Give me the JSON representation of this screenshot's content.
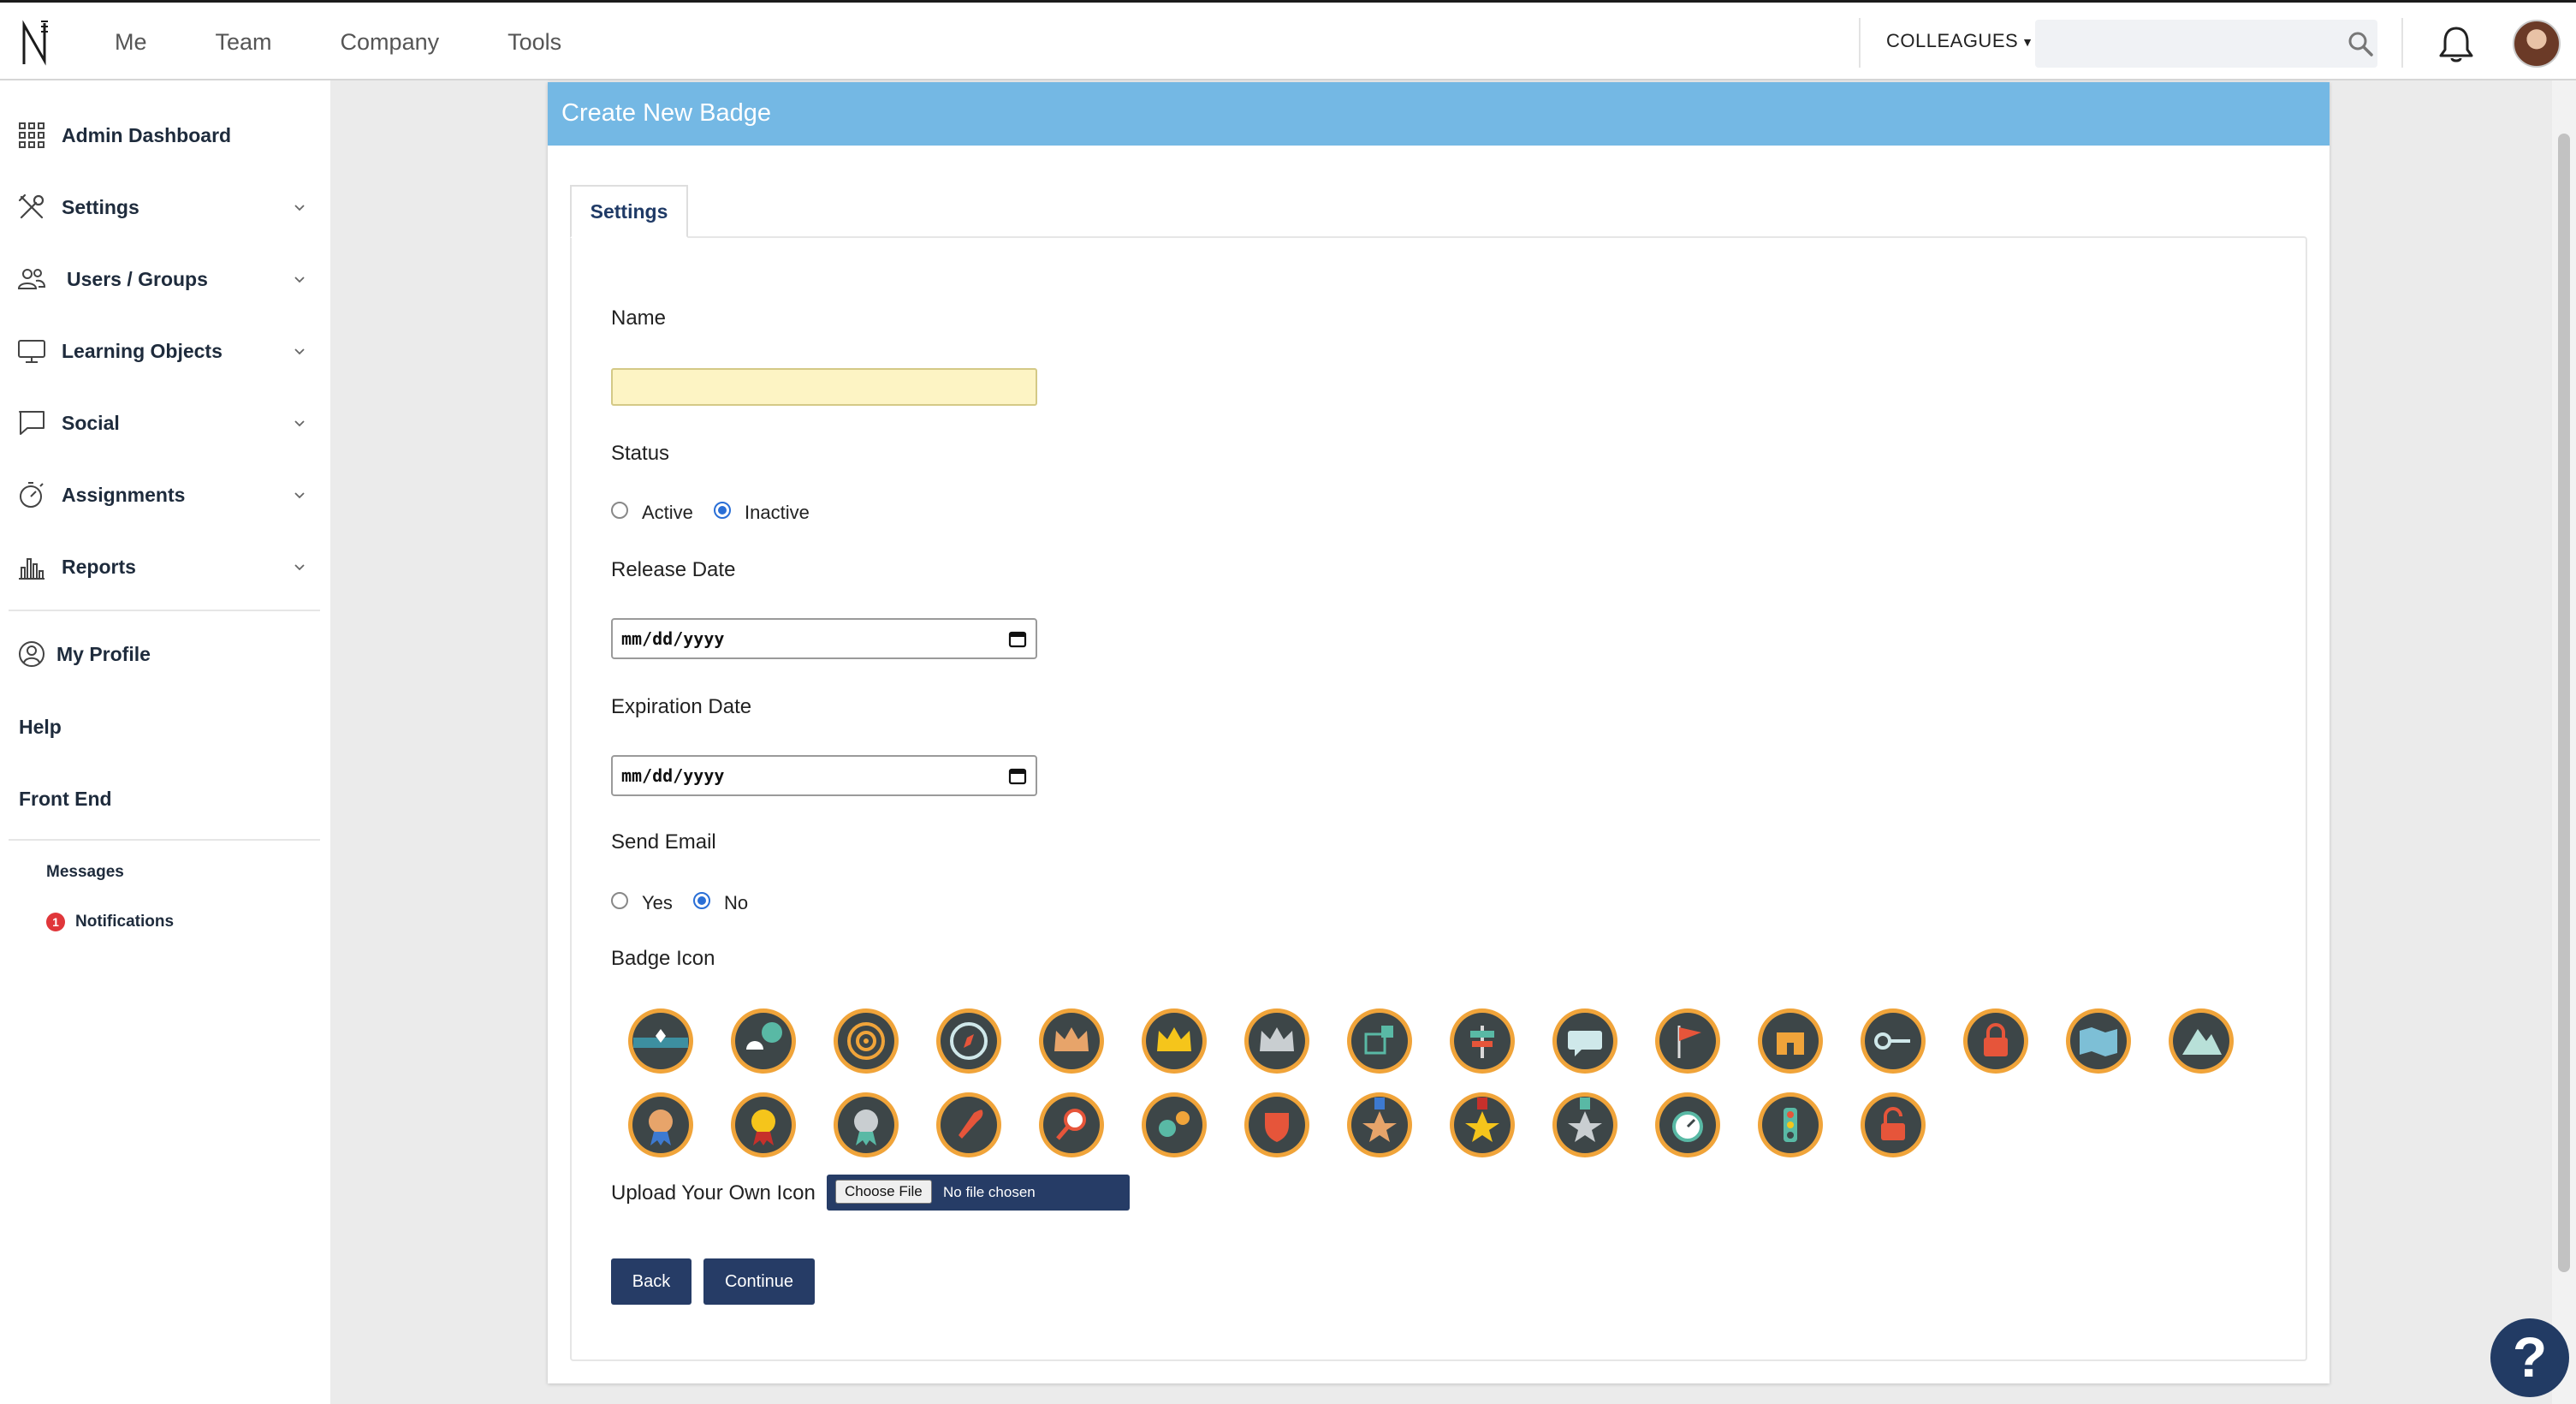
{
  "nav": {
    "links": [
      "Me",
      "Team",
      "Company",
      "Tools"
    ],
    "colleagues_label": "COLLEAGUES",
    "search_placeholder": ""
  },
  "sidebar": {
    "items": [
      {
        "label": "Admin Dashboard",
        "icon": "grid-icon"
      },
      {
        "label": "Settings",
        "icon": "tools-icon"
      },
      {
        "label": "Users / Groups",
        "icon": "users-icon"
      },
      {
        "label": "Learning Objects",
        "icon": "monitor-icon"
      },
      {
        "label": "Social",
        "icon": "chat-icon"
      },
      {
        "label": "Assignments",
        "icon": "stopwatch-icon"
      },
      {
        "label": "Reports",
        "icon": "bar-chart-icon"
      }
    ],
    "my_profile": "My Profile",
    "help": "Help",
    "front_end": "Front End",
    "messages": "Messages",
    "notifications": "Notifications",
    "notifications_count": "1"
  },
  "panel": {
    "title": "Create New Badge",
    "tab": "Settings"
  },
  "form": {
    "name_label": "Name",
    "name_value": "",
    "status_label": "Status",
    "status_options": [
      "Active",
      "Inactive"
    ],
    "status_selected": "Inactive",
    "release_label": "Release Date",
    "release_value": "mm/dd/yyyy",
    "expiration_label": "Expiration Date",
    "expiration_value": "mm/dd/yyyy",
    "email_label": "Send Email",
    "email_options": [
      "Yes",
      "No"
    ],
    "email_selected": "No",
    "badge_icon_label": "Badge Icon",
    "badge_icons": [
      "trophy-banner-icon",
      "lightbulb-cloud-icon",
      "target-icon",
      "compass-icon",
      "bronze-crown-icon",
      "gold-crown-icon",
      "silver-crown-icon",
      "dice-icon",
      "signpost-icon",
      "speech-bubble-icon",
      "flag-icon",
      "castle-icon",
      "key-icon",
      "padlock-icon",
      "treasure-map-icon",
      "mountain-icon",
      "bronze-medal-icon",
      "gold-medal-icon",
      "silver-medal-icon",
      "rocket-icon",
      "magnifier-icon",
      "gears-icon",
      "shield-icon",
      "bronze-star-medal-icon",
      "gold-star-medal-icon",
      "silver-star-medal-icon",
      "stopwatch-icon",
      "traffic-light-icon",
      "open-padlock-icon"
    ],
    "upload_label": "Upload Your Own Icon",
    "choose_file": "Choose File",
    "no_file": "No file chosen",
    "back_button": "Back",
    "continue_button": "Continue"
  },
  "help_label": "?",
  "colors": {
    "header_blue": "#74b8e4",
    "navy_button": "#263c66",
    "badge_ring": "#f0a43a",
    "badge_dark": "#3d4648"
  }
}
